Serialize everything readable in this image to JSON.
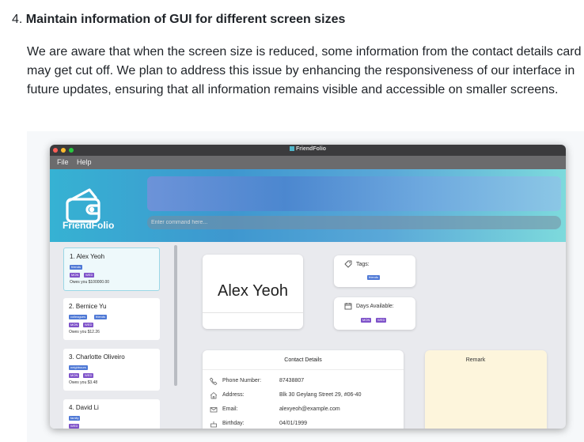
{
  "doc": {
    "heading_number": "4.",
    "heading_title": "Maintain information of GUI for different screen sizes",
    "paragraph": "We are aware that when the screen size is reduced, some information from the contact details card may get cut off. We plan to address this issue by enhancing the responsiveness of our interface in future updates, ensuring that all information remains visible and accessible on smaller screens."
  },
  "app": {
    "window_title": "FriendFolio",
    "menu": {
      "file": "File",
      "help": "Help"
    },
    "logo_text": "FriendFolio",
    "command_placeholder": "Enter command here...",
    "contacts": [
      {
        "index_name": "1.  Alex Yeoh",
        "tags": [
          "friends"
        ],
        "days": [
          "MON",
          "WED"
        ],
        "owes": "Owes you $100000.00",
        "selected": true
      },
      {
        "index_name": "2.  Bernice Yu",
        "tags": [
          "colleagues",
          "friends"
        ],
        "days": [
          "MON",
          "WED"
        ],
        "owes": "Owes you $12.26",
        "selected": false
      },
      {
        "index_name": "3.  Charlotte Oliveiro",
        "tags": [
          "neighbours"
        ],
        "days": [
          "MON",
          "WED"
        ],
        "owes": "Owes you $3.48",
        "selected": false
      },
      {
        "index_name": "4.  David Li",
        "tags": [
          "family"
        ],
        "days": [
          "WED"
        ],
        "owes": "",
        "selected": false
      }
    ],
    "detail": {
      "name": "Alex Yeoh",
      "tags_label": "Tags:",
      "tags": [
        "friends"
      ],
      "days_label": "Days Available:",
      "days": [
        "MON",
        "WED"
      ],
      "contact_title": "Contact Details",
      "rows": [
        {
          "label": "Phone Number:",
          "value": "87438807",
          "icon": "phone-icon"
        },
        {
          "label": "Address:",
          "value": "Blk 30 Geylang Street 29, #06-40",
          "icon": "home-icon"
        },
        {
          "label": "Email:",
          "value": "alexyeoh@example.com",
          "icon": "mail-icon"
        },
        {
          "label": "Birthday:",
          "value": "04/01/1999",
          "icon": "cake-icon"
        }
      ],
      "remark_title": "Remark"
    }
  },
  "colors": {
    "tag_pill": "#4f79d6",
    "day_pill": "#7e52c9",
    "banner_accent": "#3e97cf",
    "remark_bg": "#fdf5dc"
  }
}
